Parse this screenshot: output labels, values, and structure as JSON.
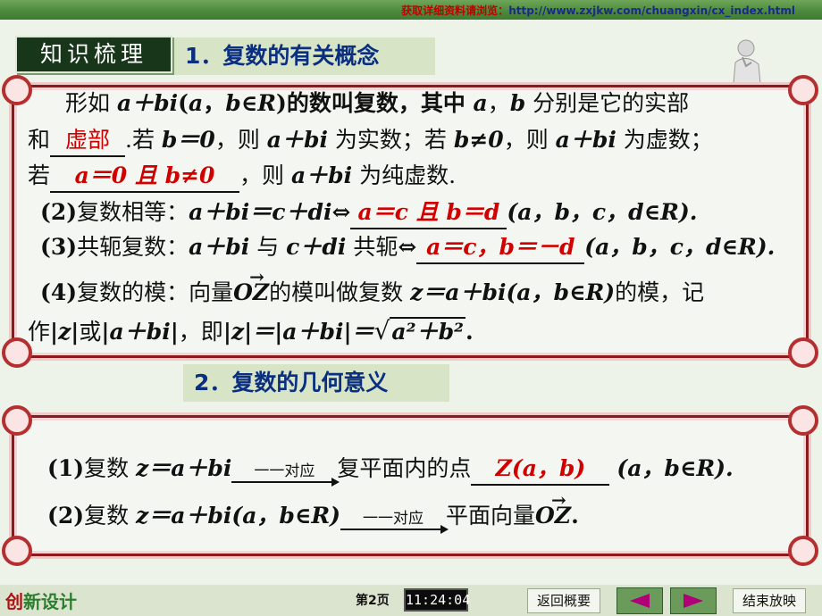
{
  "header": {
    "link_prefix": "获取详细资料请浏览：",
    "link_url": "http://www.zxjkw.com/chuangxin/cx_index.html"
  },
  "badge": "知识梳理",
  "sec1": {
    "title": "1．复数的有关概念"
  },
  "sec2": {
    "title": "2．复数的几何意义"
  },
  "def": {
    "l1a": "形如 ",
    "expr": "a＋bi",
    "l1b": "(",
    "a": "a",
    "comma": "，",
    "b": "b",
    "inR": "∈R",
    "l1c": ")的数叫复数，其中 ",
    "l1d": "a",
    "l1e": "，",
    "l1f": "b",
    "l1g": " 分别是它的实部",
    "l2a": "和",
    "blank_imag": "虚部",
    "l2b": ".若 ",
    "b0": "b＝0",
    "l2c": "，则 ",
    "abi1": "a＋bi",
    "l2d": " 为实数；若 ",
    "bn0": "b≠0",
    "l2e": "，则 ",
    "abi2": "a＋bi",
    "l2f": " 为虚数；",
    "l3a": "若",
    "blank_pure": "a＝0 且 b≠0",
    "l3b": "，则 ",
    "abi3": "a＋bi",
    "l3c": " 为纯虚数."
  },
  "eq": {
    "num": "(2)",
    "label": "复数相等：",
    "lhs": "a＋bi＝c＋di",
    "iff": "⇔",
    "blank": "a＝c 且 b＝d",
    "cond": "(a，b，c，d∈R)."
  },
  "conj": {
    "num": "(3)",
    "label": "共轭复数：",
    "lhs": "a＋bi",
    "with": " 与 ",
    "rhs": "c＋di",
    "word": " 共轭",
    "iff": "⇔",
    "blank": "a＝c，b＝－d",
    "cond": "(a，b，c，d∈R)."
  },
  "mod": {
    "num": "(4)",
    "l1a": "复数的模：向量",
    "vec": "OZ",
    "l1b": "的模叫做复数 ",
    "z": "z＝a＋bi",
    "l1c": "(a，b∈R)",
    "l1d": "的模，记",
    "l2a": "作",
    "absz": "|z|",
    "or": "或",
    "absabi": "|a＋bi|",
    "l2b": "，即",
    "eq": "|z|＝|a＋bi|＝",
    "root": "a²＋b²",
    "end": "."
  },
  "geo": {
    "p1num": "(1)",
    "p1a": "复数 ",
    "p1z": "z＝a＋bi",
    "p1arrow": "一一对应",
    "p1b": "复平面内的点",
    "p1blank": "Z(a，b)",
    "p1cond": "(a，b∈R).",
    "p2num": "(2)",
    "p2a": "复数 ",
    "p2z": "z＝a＋bi",
    "p2c": "(a，b∈R)",
    "p2arrow": "一一对应",
    "p2b": "平面向量",
    "p2vec": "OZ",
    "p2end": "."
  },
  "footer": {
    "logo_a": "创",
    "logo_b": "新设计",
    "page": "第2页",
    "clock": "11:24:04",
    "back": "返回概要",
    "end": "结束放映"
  }
}
